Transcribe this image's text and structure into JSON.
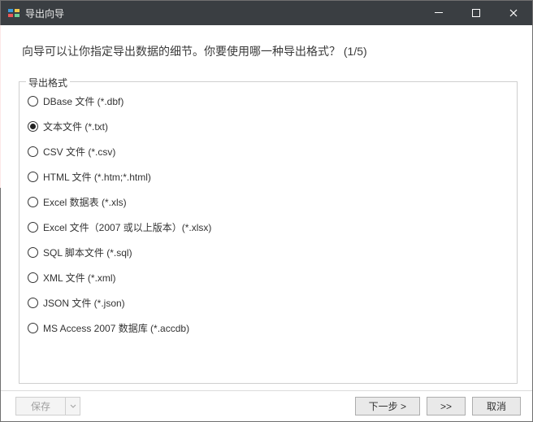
{
  "titlebar": {
    "title": "导出向导"
  },
  "prompt": {
    "text": "向导可以让你指定导出数据的细节。你要使用哪一种导出格式？",
    "step": "(1/5)"
  },
  "group": {
    "legend": "导出格式"
  },
  "formats": [
    {
      "label": "DBase 文件 (*.dbf)",
      "checked": false
    },
    {
      "label": "文本文件 (*.txt)",
      "checked": true
    },
    {
      "label": "CSV 文件 (*.csv)",
      "checked": false
    },
    {
      "label": "HTML 文件 (*.htm;*.html)",
      "checked": false
    },
    {
      "label": "Excel 数据表 (*.xls)",
      "checked": false
    },
    {
      "label": "Excel 文件（2007 或以上版本）(*.xlsx)",
      "checked": false
    },
    {
      "label": "SQL 脚本文件 (*.sql)",
      "checked": false
    },
    {
      "label": "XML 文件 (*.xml)",
      "checked": false
    },
    {
      "label": "JSON 文件 (*.json)",
      "checked": false
    },
    {
      "label": "MS Access 2007 数据库 (*.accdb)",
      "checked": false
    }
  ],
  "footer": {
    "save": "保存",
    "next": "下一步 >",
    "skip": ">>",
    "cancel": "取消"
  }
}
